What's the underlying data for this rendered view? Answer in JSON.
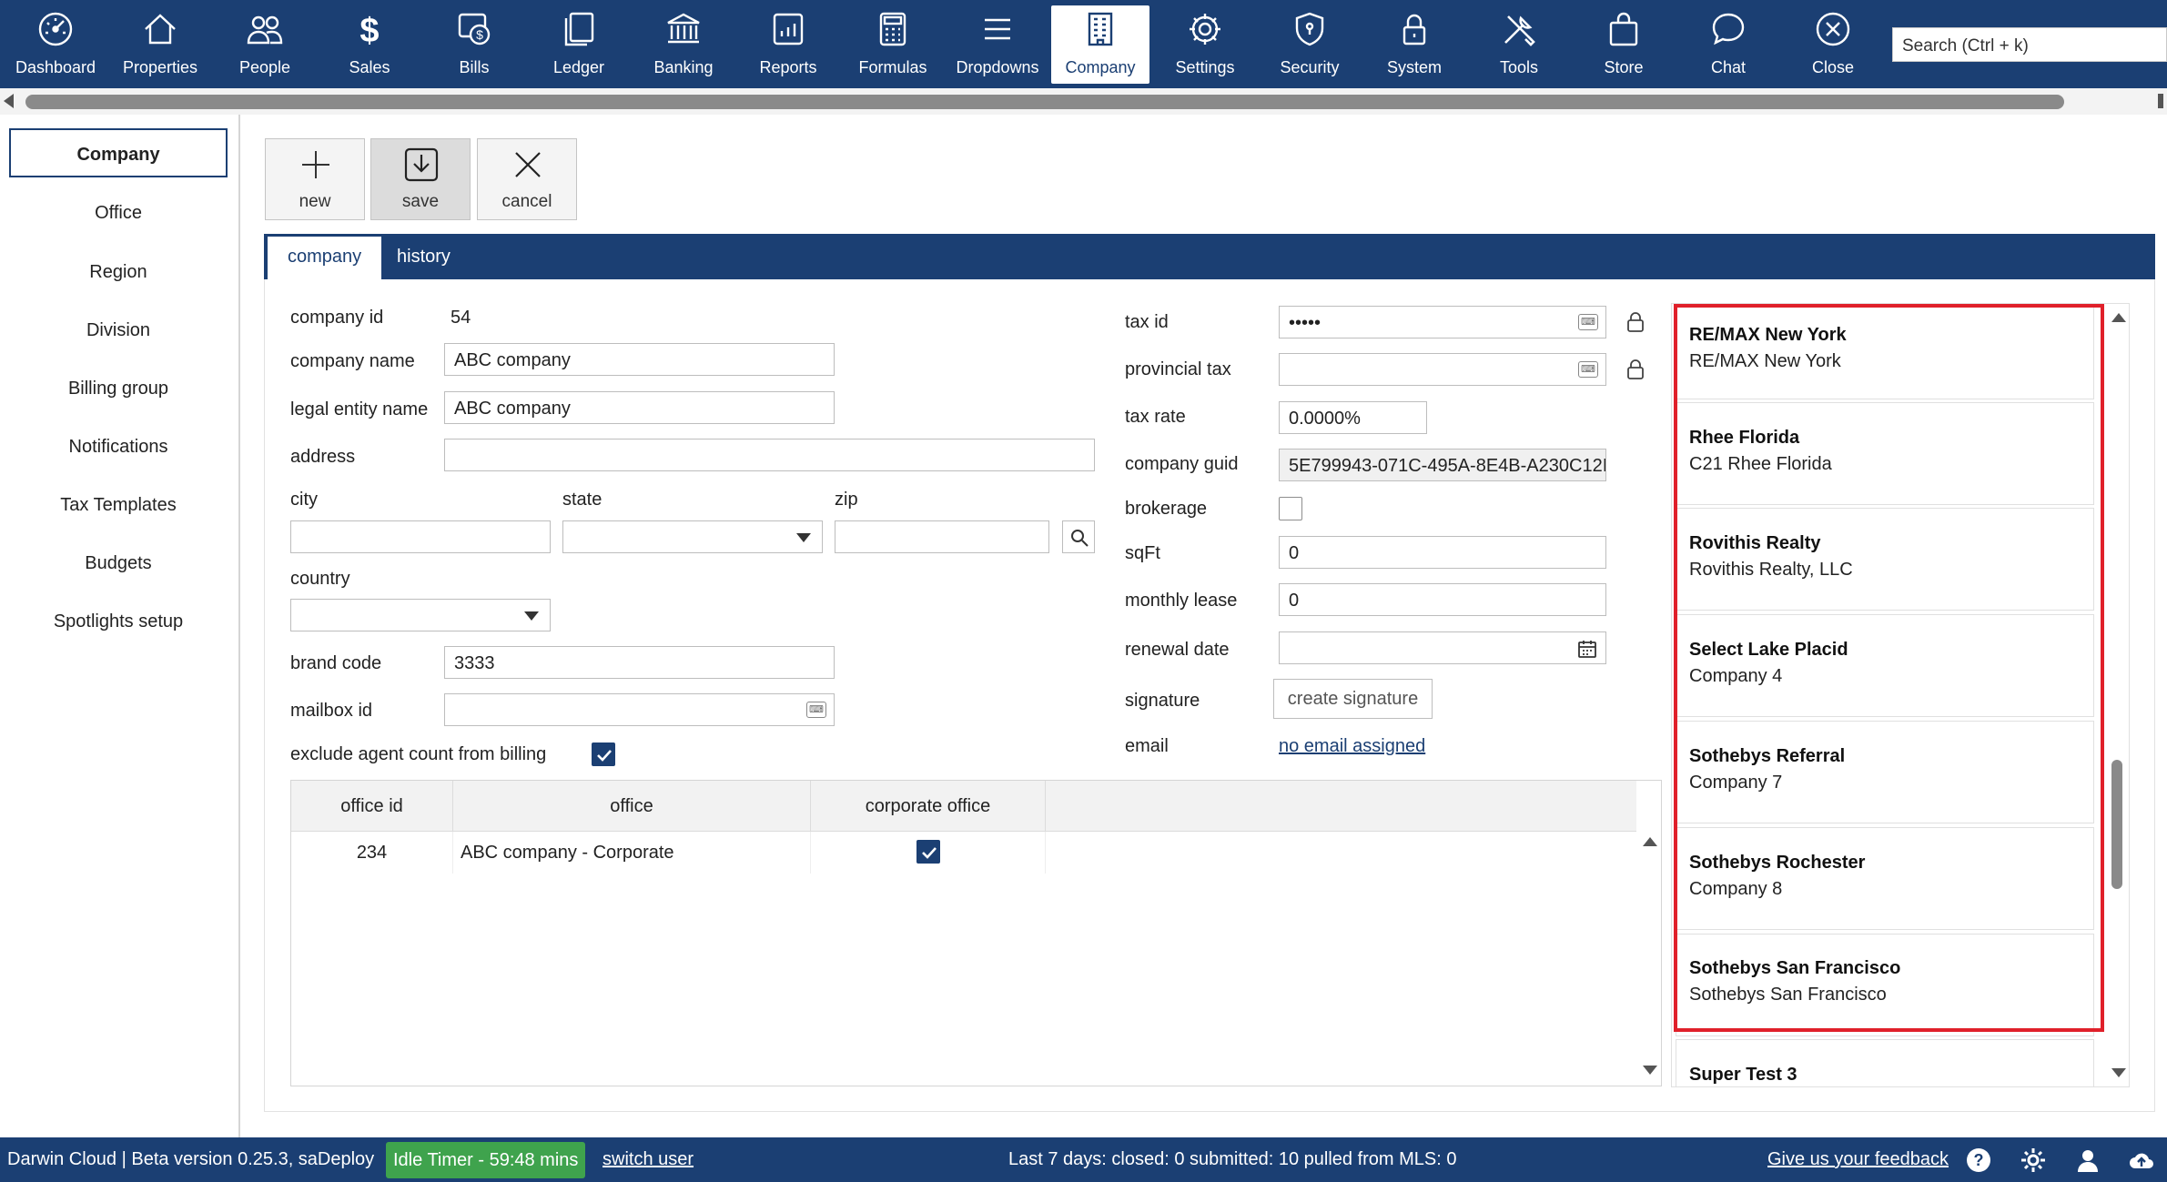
{
  "nav": {
    "items": [
      {
        "label": "Dashboard",
        "icon": "dashboard-gauge-icon"
      },
      {
        "label": "Properties",
        "icon": "house-icon"
      },
      {
        "label": "People",
        "icon": "people-icon"
      },
      {
        "label": "Sales",
        "icon": "dollar-icon"
      },
      {
        "label": "Bills",
        "icon": "bills-icon"
      },
      {
        "label": "Ledger",
        "icon": "ledger-icon"
      },
      {
        "label": "Banking",
        "icon": "bank-icon"
      },
      {
        "label": "Reports",
        "icon": "reports-icon"
      },
      {
        "label": "Formulas",
        "icon": "calculator-icon"
      },
      {
        "label": "Dropdowns",
        "icon": "menu-lines-icon"
      },
      {
        "label": "Company",
        "icon": "building-icon"
      },
      {
        "label": "Settings",
        "icon": "gear-icon"
      },
      {
        "label": "Security",
        "icon": "shield-icon"
      },
      {
        "label": "System",
        "icon": "lock-icon"
      },
      {
        "label": "Tools",
        "icon": "tools-icon"
      },
      {
        "label": "Store",
        "icon": "shopping-bag-icon"
      },
      {
        "label": "Chat",
        "icon": "chat-bubble-icon"
      },
      {
        "label": "Close",
        "icon": "close-circle-icon"
      }
    ],
    "active": "Company",
    "search_placeholder": "Search (Ctrl + k)"
  },
  "sidebar": {
    "items": [
      {
        "label": "Company",
        "active": true
      },
      {
        "label": "Office"
      },
      {
        "label": "Region"
      },
      {
        "label": "Division"
      },
      {
        "label": "Billing group"
      },
      {
        "label": "Notifications"
      },
      {
        "label": "Tax Templates"
      },
      {
        "label": "Budgets"
      },
      {
        "label": "Spotlights setup"
      }
    ]
  },
  "actions": {
    "new_label": "new",
    "save_label": "save",
    "cancel_label": "cancel"
  },
  "tabs": {
    "company": "company",
    "history": "history"
  },
  "form": {
    "company_id_label": "company id",
    "company_id_value": "54",
    "company_name_label": "company name",
    "company_name_value": "ABC company",
    "legal_entity_label": "legal entity name",
    "legal_entity_value": "ABC company",
    "address_label": "address",
    "address_value": "",
    "city_label": "city",
    "state_label": "state",
    "zip_label": "zip",
    "country_label": "country",
    "brand_code_label": "brand code",
    "brand_code_value": "3333",
    "mailbox_id_label": "mailbox id",
    "exclude_label": "exclude agent count from billing",
    "tax_id_label": "tax id",
    "tax_id_value": "•••••",
    "provincial_tax_label": "provincial tax",
    "tax_rate_label": "tax rate",
    "tax_rate_value": "0.0000%",
    "company_guid_label": "company guid",
    "company_guid_value": "5E799943-071C-495A-8E4B-A230C12I",
    "brokerage_label": "brokerage",
    "sqft_label": "sqFt",
    "sqft_value": "0",
    "monthly_lease_label": "monthly lease",
    "monthly_lease_value": "0",
    "renewal_date_label": "renewal date",
    "signature_label": "signature",
    "create_signature_label": "create signature",
    "email_label": "email",
    "email_link": "no email assigned"
  },
  "office_grid": {
    "headers": [
      "office id",
      "office",
      "corporate office"
    ],
    "rows": [
      {
        "office_id": "234",
        "office": "ABC company - Corporate",
        "corporate": true
      }
    ]
  },
  "company_list": [
    {
      "title": "RE/MAX New York",
      "subtitle": "RE/MAX New York"
    },
    {
      "title": "Rhee Florida",
      "subtitle": "C21 Rhee Florida"
    },
    {
      "title": "Rovithis Realty",
      "subtitle": "Rovithis Realty, LLC"
    },
    {
      "title": "Select Lake Placid",
      "subtitle": "Company 4"
    },
    {
      "title": "Sothebys Referral",
      "subtitle": "Company 7"
    },
    {
      "title": "Sothebys Rochester",
      "subtitle": "Company 8"
    },
    {
      "title": "Sothebys San Francisco",
      "subtitle": "Sothebys San Francisco"
    },
    {
      "title": "Super Test 3",
      "subtitle": ""
    }
  ],
  "status": {
    "app_version": "Darwin Cloud | Beta version 0.25.3, saDeploy",
    "idle_timer": "Idle Timer - 59:48 mins",
    "switch_user": "switch user",
    "summary": "Last 7 days: closed: 0 submitted: 10 pulled from MLS: 0",
    "feedback": "Give us your feedback"
  },
  "colors": {
    "brand": "#1b3f73",
    "idle_green": "#3fa34d",
    "highlight_red": "#e0202a"
  }
}
